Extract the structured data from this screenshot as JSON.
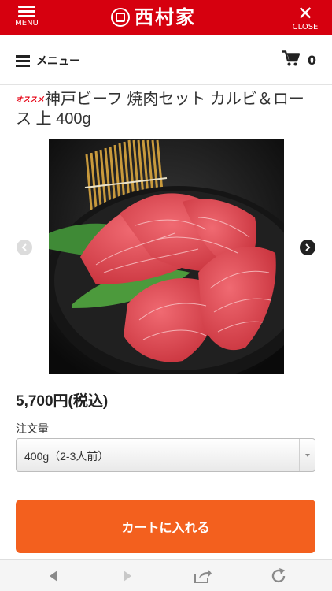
{
  "header": {
    "menu_label": "MENU",
    "logo_text": "西村家",
    "close_label": "CLOSE"
  },
  "subnav": {
    "menu_label": "メニュー",
    "cart_count": "0"
  },
  "product": {
    "badge": "オススメ",
    "title": "神戸ビーフ 焼肉セット カルビ＆ロース 上 400g",
    "price": "5,700円(税込)",
    "quantity_label": "注文量",
    "quantity_selected": "400g（2-3人前）",
    "add_to_cart_label": "カートに入れる"
  },
  "colors": {
    "header_red": "#d6000f",
    "cart_button": "#f3601e",
    "badge_red": "#e60012"
  },
  "icons": {
    "menu": "hamburger-icon",
    "close": "close-icon",
    "cart": "cart-icon",
    "gallery_prev": "chevron-left-icon",
    "gallery_next": "chevron-right-icon",
    "back": "back-arrow-icon",
    "forward": "forward-arrow-icon",
    "share": "share-icon",
    "reload": "reload-icon"
  }
}
